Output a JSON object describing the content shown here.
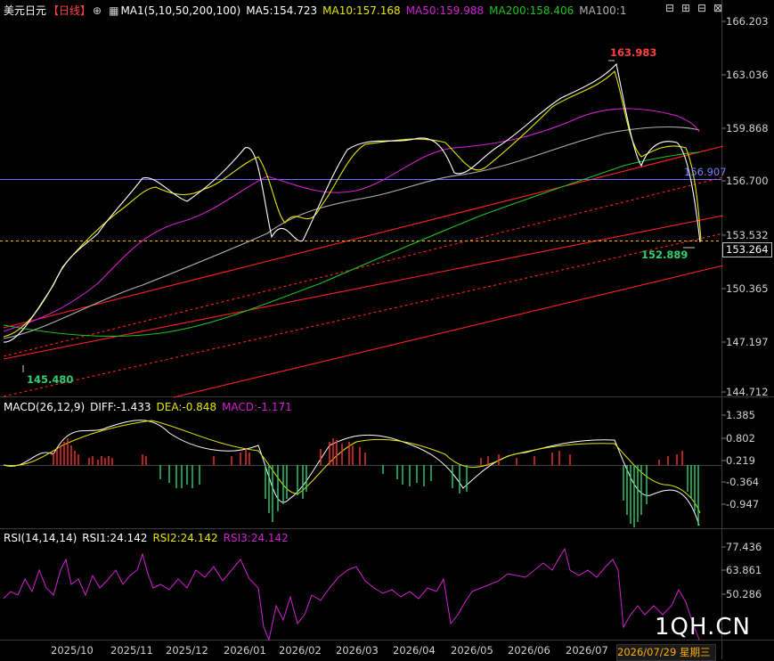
{
  "header": {
    "symbol": "美元日元",
    "period": "【日线】",
    "ma_label": "MA1(5,10,50,200,100)",
    "ma5": "MA5:154.723",
    "ma10": "MA10:157.168",
    "ma50": "MA50:159.988",
    "ma200": "MA200:158.406",
    "ma100": "MA100:1"
  },
  "macd_header": {
    "name": "MACD(26,12,9)",
    "diff": "DIFF:-1.433",
    "dea": "DEA:-0.848",
    "macd": "MACD:-1.171"
  },
  "rsi_header": {
    "name": "RSI(14,14,14)",
    "rsi1": "RSI1:24.142",
    "rsi2": "RSI2:24.142",
    "rsi3": "RSI3:24.142"
  },
  "price_ticks": [
    "166.203",
    "163.036",
    "159.868",
    "156.700",
    "153.532",
    "150.365",
    "147.197",
    "144.712"
  ],
  "macd_ticks": [
    "1.385",
    "0.802",
    "0.219",
    "-0.364",
    "-0.947"
  ],
  "rsi_ticks": [
    "77.436",
    "63.861",
    "50.286"
  ],
  "x_labels": [
    "2025/10",
    "2025/11",
    "2025/12",
    "2026/01",
    "2026/02",
    "2026/03",
    "2026/04",
    "2026/05",
    "2026/06",
    "2026/07"
  ],
  "annotations": {
    "high": "163.983",
    "low": "145.480",
    "recent_low": "152.889",
    "hline_value": "156.907",
    "last_price": "153.264"
  },
  "date_badge": {
    "date": "2026/07/29",
    "weekday": "星期三"
  },
  "watermark": "1QH.CN",
  "colors": {
    "ma5": "#ffffff",
    "ma10": "#e6e600",
    "ma50": "#d020d0",
    "ma200": "#20c020",
    "ma100": "#b0b0b0",
    "up": "#ff3030",
    "down": "#30d070",
    "trend": "#ff2020",
    "hline": "#6f6fff",
    "lastprice": "#ffb000"
  },
  "chart_data": [
    {
      "type": "candlestick",
      "title": "美元日元【日线】",
      "ylim": [
        144.712,
        166.203
      ],
      "series": [
        {
          "name": "MA5",
          "values": [
            154.723
          ]
        },
        {
          "name": "MA10",
          "values": [
            157.168
          ]
        },
        {
          "name": "MA50",
          "values": [
            159.988
          ]
        },
        {
          "name": "MA200",
          "values": [
            158.406
          ]
        }
      ],
      "annotations": [
        {
          "label": "163.983",
          "kind": "high"
        },
        {
          "label": "145.480",
          "kind": "low"
        },
        {
          "label": "152.889",
          "kind": "recent-low"
        },
        {
          "label": "156.907",
          "kind": "horizontal-line"
        },
        {
          "label": "153.264",
          "kind": "last-price"
        }
      ]
    },
    {
      "type": "bar",
      "title": "MACD(26,12,9)",
      "ylim": [
        -1.2,
        1.5
      ],
      "series": [
        {
          "name": "DIFF",
          "values": [
            -1.433
          ]
        },
        {
          "name": "DEA",
          "values": [
            -0.848
          ]
        },
        {
          "name": "MACD",
          "values": [
            -1.171
          ]
        }
      ]
    },
    {
      "type": "line",
      "title": "RSI(14,14,14)",
      "series": [
        {
          "name": "RSI1",
          "values": [
            24.142
          ]
        },
        {
          "name": "RSI2",
          "values": [
            24.142
          ]
        },
        {
          "name": "RSI3",
          "values": [
            24.142
          ]
        }
      ]
    }
  ]
}
